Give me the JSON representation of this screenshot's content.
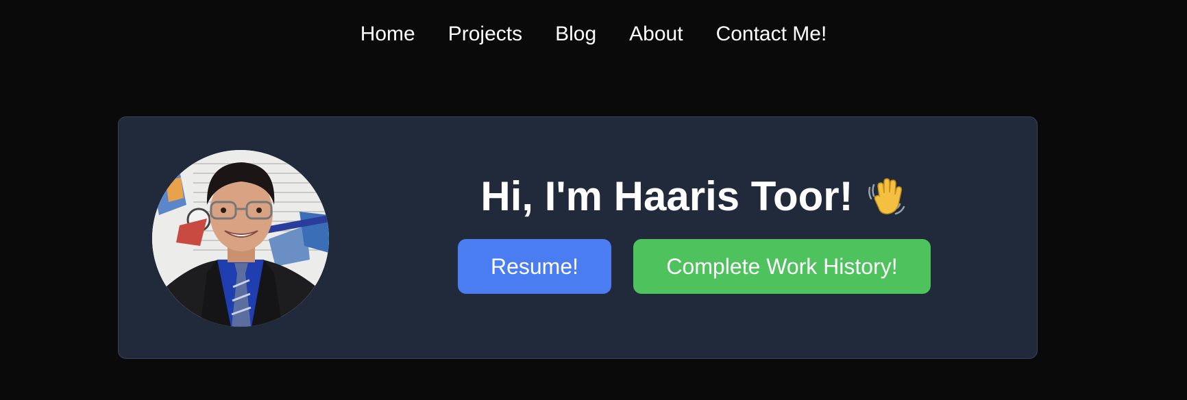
{
  "nav": {
    "items": [
      {
        "label": "Home"
      },
      {
        "label": "Projects"
      },
      {
        "label": "Blog"
      },
      {
        "label": "About"
      },
      {
        "label": "Contact Me!"
      }
    ]
  },
  "hero": {
    "title": "Hi, I'm Haaris Toor!",
    "wave_icon": "waving-hand-icon",
    "avatar_icon": "profile-photo",
    "resume_label": "Resume!",
    "history_label": "Complete Work History!"
  },
  "colors": {
    "background": "#0a0a0a",
    "card": "#212a3a",
    "resume_button": "#4a7cf2",
    "history_button": "#4ec25c"
  }
}
